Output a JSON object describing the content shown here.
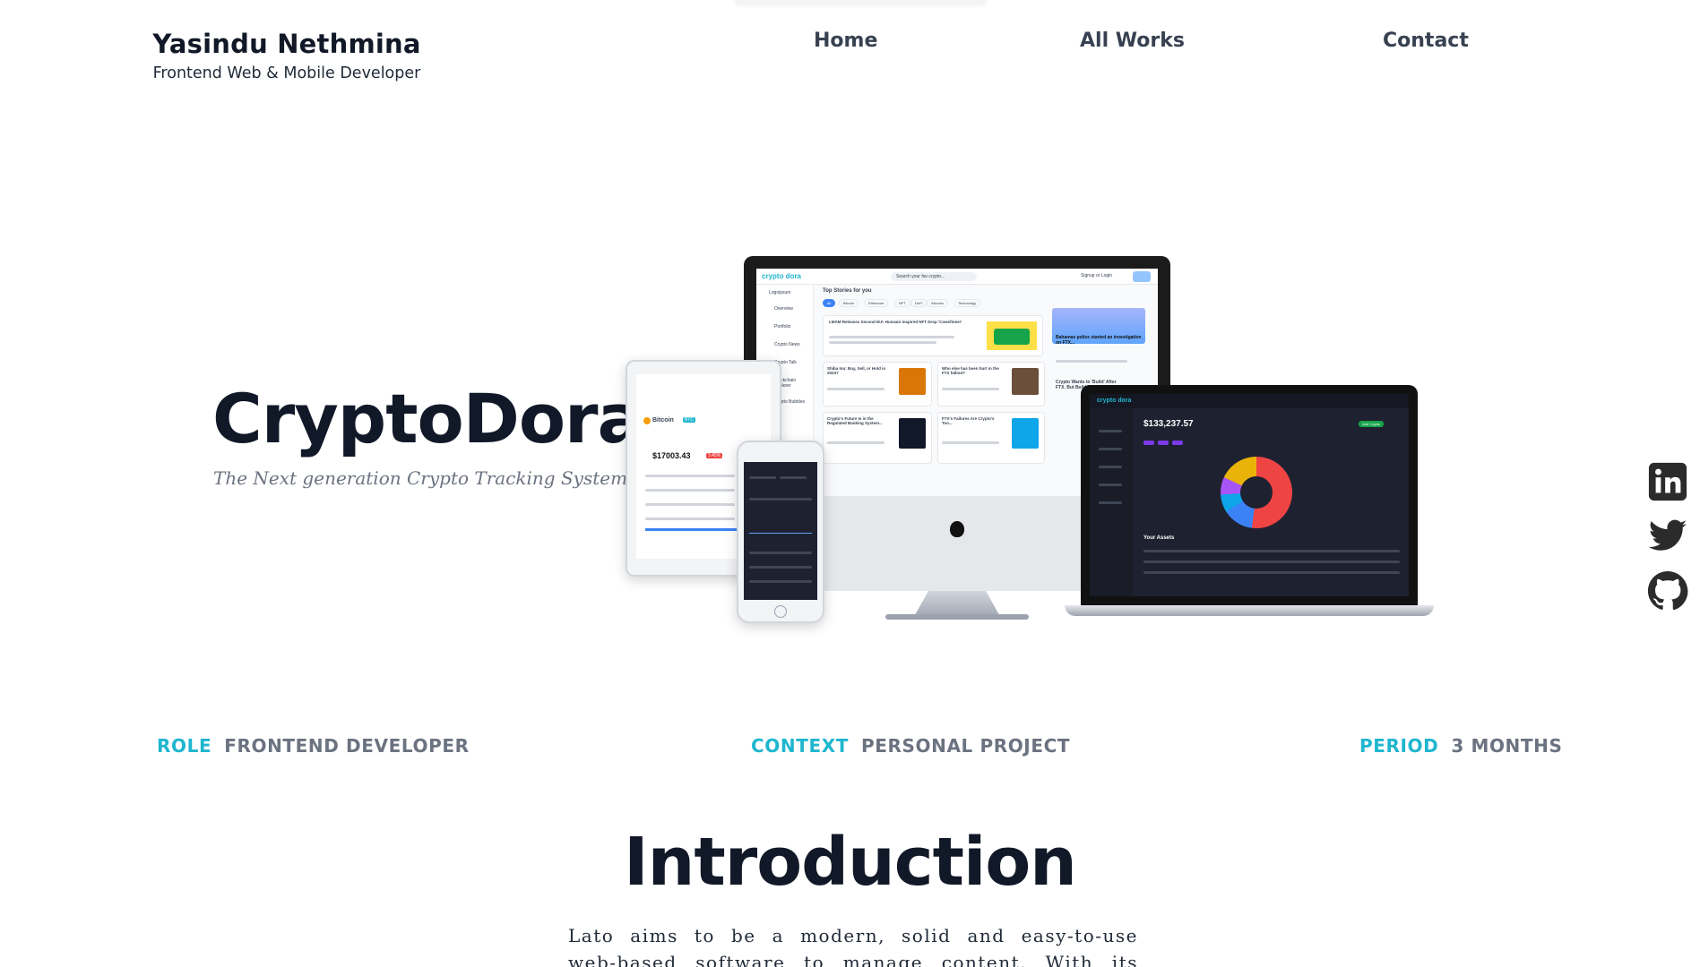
{
  "brand": {
    "name": "Yasindu Nethmina",
    "tagline": "Frontend Web & Mobile Developer"
  },
  "nav": {
    "items": [
      {
        "label": "Home"
      },
      {
        "label": "All Works"
      },
      {
        "label": "Contact"
      }
    ]
  },
  "hero": {
    "title": "CryptoDora",
    "subtitle": "The Next generation Crypto Tracking System."
  },
  "mockup": {
    "desktop": {
      "logo": "crypto dora",
      "search_placeholder": "Search your fav crypto...",
      "auth": "Signup or Login",
      "section": "Top Stories for you",
      "filters": [
        "All",
        "Bitcoin",
        "Ethereum",
        "NFT",
        "DeFi",
        "Altcoins",
        "Technology"
      ],
      "sidebar": [
        "Logoipsum",
        "Overview",
        "Portfolio",
        "Crypto News",
        "Crypto Talk",
        "Blockchain Explorer",
        "Crypto Bubbles"
      ],
      "stories": [
        "LMAM Releases Second M.F. Hussain Inspired NFT Drop 'Cowsfineer'",
        "Shiba Inu: Buy, Sell, or Hold in 2023?",
        "Who else has been hurt in the FTX fallout?",
        "Crypto's Future Is in the Regulated Banking System...",
        "FTX's Failures Are Crypto's Too...",
        "Bahamas police started an investigation on FTX...",
        "Crypto Wants to 'Build' After FTX. But Build What?"
      ]
    },
    "tablet": {
      "coin": "Bitcoin",
      "ticker": "BTC",
      "price": "$17003.43",
      "change": "3.45%"
    },
    "laptop": {
      "logo": "crypto dora",
      "balance": "$133,237.57",
      "assets_label": "Your Assets",
      "add_button": "Add Crypto"
    }
  },
  "social": [
    {
      "name": "LinkedIn",
      "icon": "linkedin-icon"
    },
    {
      "name": "Twitter",
      "icon": "twitter-icon"
    },
    {
      "name": "GitHub",
      "icon": "github-icon"
    }
  ],
  "meta": {
    "role": {
      "key": "ROLE",
      "value": "FRONTEND DEVELOPER"
    },
    "context": {
      "key": "CONTEXT",
      "value": "PERSONAL PROJECT"
    },
    "period": {
      "key": "PERIOD",
      "value": "3 MONTHS"
    }
  },
  "intro": {
    "title": "Introduction",
    "text": "Lato aims to be a modern, solid and easy-to-use web-based software to manage content. With its intuitive"
  },
  "colors": {
    "accent": "#1fb6cf",
    "heading": "#111827",
    "muted": "#6b7280",
    "nav": "#374151"
  }
}
